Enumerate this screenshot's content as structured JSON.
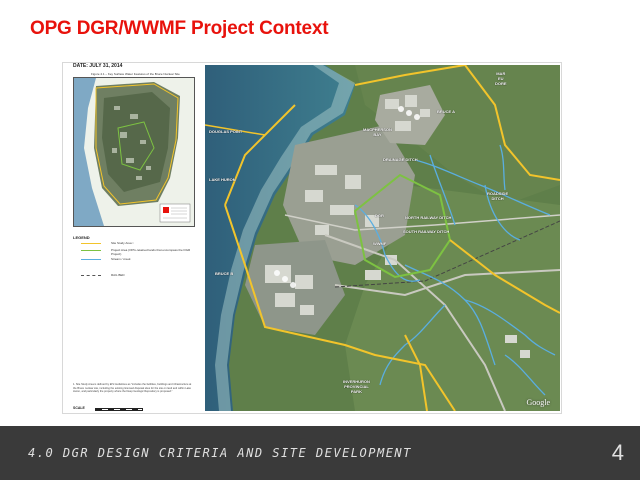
{
  "slide": {
    "title": "OPG DGR/WWMF Project Context",
    "footer_text": "4.0 DGR DESIGN CRITERIA AND SITE DEVELOPMENT",
    "page_number": "4"
  },
  "figure": {
    "date": "DATE: JULY 31, 2014",
    "inset_title": "Figure 4.1 – Key Surface Water Features of the Bruce Nuclear Site",
    "legend_title": "LEGEND",
    "legend_items": [
      {
        "label": "Site Study Area ¹",
        "color": "#f2c42b",
        "style": "solid"
      },
      {
        "label": "Project Area (OPG-retained lands that encompass the DGR Project)",
        "color": "#7dc242",
        "style": "solid"
      },
      {
        "label": "Stream / creek",
        "color": "#5aaee0",
        "style": "solid"
      },
      {
        "label": "RAIL BED",
        "color": "#555555",
        "style": "dashed"
      }
    ],
    "footnote": "1. Site Study Area is defined by EIS Guidelines as \"includes the facilities, buildings and infrastructure at the Bruce nuclear site, including the existing licensed disposal sites for the site on land and within Lake Huron, and particularly the property where the Deep Geologic Repository is proposed.\"",
    "scale_label": "SCALE",
    "map_labels": [
      {
        "text": "MAR\nEU\nDORE"
      },
      {
        "text": "MACPHERSON\nBAY"
      },
      {
        "text": "BRUCE A"
      },
      {
        "text": "DOUGLAS POINT"
      },
      {
        "text": "DRAINAGE DITCH"
      },
      {
        "text": "LAKE HURON"
      },
      {
        "text": "NORTH RAILWAY DITCH"
      },
      {
        "text": "DGR"
      },
      {
        "text": "SOUTH RAILWAY DITCH"
      },
      {
        "text": "WWMF"
      },
      {
        "text": "ROADSIDE\nDITCH"
      },
      {
        "text": "BRUCE B"
      },
      {
        "text": "INVERHURON\nPROVINCIAL\nPARK"
      },
      {
        "text": "Google"
      }
    ]
  },
  "colors": {
    "title_red": "#e8120c",
    "footer_bg": "#3a3a3a",
    "study_area": "#f2c42b",
    "project_area": "#7dc242",
    "stream": "#5aaee0"
  }
}
